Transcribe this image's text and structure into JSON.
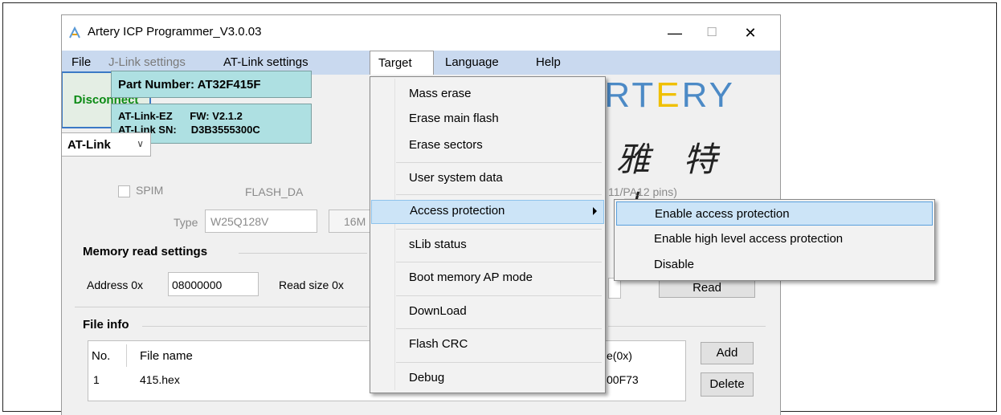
{
  "window": {
    "title": "Artery ICP Programmer_V3.0.03",
    "minimize": "—",
    "maximize": "☐",
    "close": "✕"
  },
  "menubar": {
    "file": "File",
    "jlink": "J-Link settings",
    "atlink": "AT-Link settings",
    "target": "Target",
    "language": "Language",
    "help": "Help"
  },
  "connection": {
    "disconnect_label": "Disconnect",
    "part_number": "Part Number:   AT32F415F",
    "link_line1": "AT-Link-EZ      FW: V2.1.2",
    "link_line2": "AT-Link SN:     D3B3555300C",
    "interface": "AT-Link",
    "interface_arrow": "∨"
  },
  "logo": {
    "prefix": "∴",
    "text_a": "ΛRT",
    "text_e": "E",
    "text_b": "RY",
    "cn": "雅 特 力"
  },
  "spim": {
    "spim_label": "SPIM",
    "flash_label": "FLASH_DA",
    "pins_label": "11/PA12 pins)",
    "type_label": "Type",
    "type_value": "W25Q128V",
    "size_value": "16M"
  },
  "memory_read": {
    "group_title": "Memory read settings",
    "address_label": "Address 0x",
    "address_value": "08000000",
    "read_size_label": "Read size  0x",
    "read_button": "Read"
  },
  "file_info": {
    "group_title": "File info",
    "col_no": "No.",
    "col_name": "File name",
    "col_size": "e(0x)",
    "rows": [
      {
        "no": "1",
        "name": "415.hex",
        "size": "00F73"
      }
    ],
    "add_button": "Add",
    "delete_button": "Delete"
  },
  "target_menu": {
    "items": [
      "Mass erase",
      "Erase main flash",
      "Erase sectors",
      "User system data",
      "Access protection",
      "sLib status",
      "Boot memory AP mode",
      "DownLoad",
      "Flash CRC",
      "Debug"
    ]
  },
  "access_submenu": {
    "items": [
      "Enable access protection",
      "Enable high level access protection",
      "Disable"
    ]
  },
  "colors": {
    "menubar_bg": "#c9d9ef",
    "highlight": "#cce4f7",
    "connect_green": "#0b8a14",
    "info_cyan": "#aee0e2",
    "logo_blue": "#4c8ac6",
    "logo_yellow": "#f0c000"
  }
}
